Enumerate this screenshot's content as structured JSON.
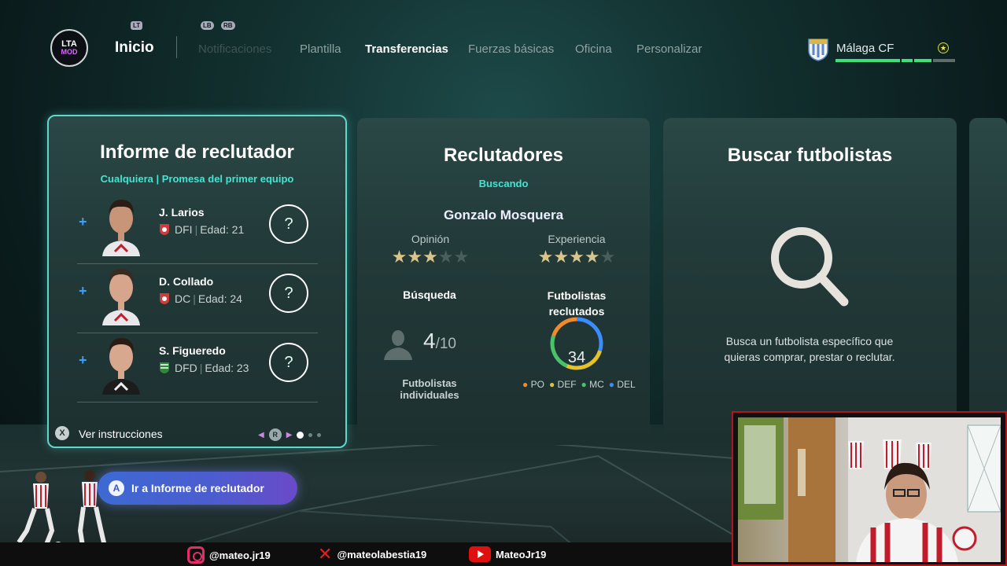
{
  "nav": {
    "lt_hint": "LT",
    "lb_hint": "LB",
    "rb_hint": "RB",
    "logo_top": "LTA",
    "logo_bottom": "MOD",
    "home": "Inicio",
    "items": [
      "Notificaciones",
      "Plantilla",
      "Transferencias",
      "Fuerzas básicas",
      "Oficina",
      "Personalizar"
    ],
    "active": "Transferencias"
  },
  "club": {
    "name": "Málaga CF",
    "star": "★"
  },
  "report_card": {
    "title": "Informe de reclutador",
    "subtitle": "Cualquiera | Promesa del primer equipo",
    "players": [
      {
        "name": "J. Larios",
        "position": "DFI",
        "age_label": "Edad: 21",
        "rating": "?"
      },
      {
        "name": "D. Collado",
        "position": "DC",
        "age_label": "Edad: 24",
        "rating": "?"
      },
      {
        "name": "S. Figueredo",
        "position": "DFD",
        "age_label": "Edad: 23",
        "rating": "?"
      }
    ],
    "footer_key": "X",
    "footer_label": "Ver instrucciones",
    "pager_key": "R"
  },
  "scouts_card": {
    "title": "Reclutadores",
    "status": "Buscando",
    "scout_name": "Gonzalo Mosquera",
    "opinion_label": "Opinión",
    "opinion_stars": 3,
    "experience_label": "Experiencia",
    "experience_stars": 4,
    "search_label": "Búsqueda",
    "search_count": "4",
    "search_total": "/10",
    "search_caption": "Futbolistas individuales",
    "recruited_label": "Futbolistas reclutados",
    "recruited_count": "34",
    "legend": [
      "PO",
      "DEF",
      "MC",
      "DEL"
    ],
    "legend_colors": [
      "#f08a2a",
      "#e6c229",
      "#4bc26a",
      "#3a8cff"
    ]
  },
  "search_card": {
    "title": "Buscar futbolistas",
    "description": "Busca un futbolista específico que quieras comprar, prestar o reclutar."
  },
  "action_button": {
    "key": "A",
    "label": "Ir a Informe de reclutador"
  },
  "social": {
    "instagram": "@mateo.jr19",
    "x": "@mateolabestia19",
    "youtube": "MateoJr19"
  }
}
